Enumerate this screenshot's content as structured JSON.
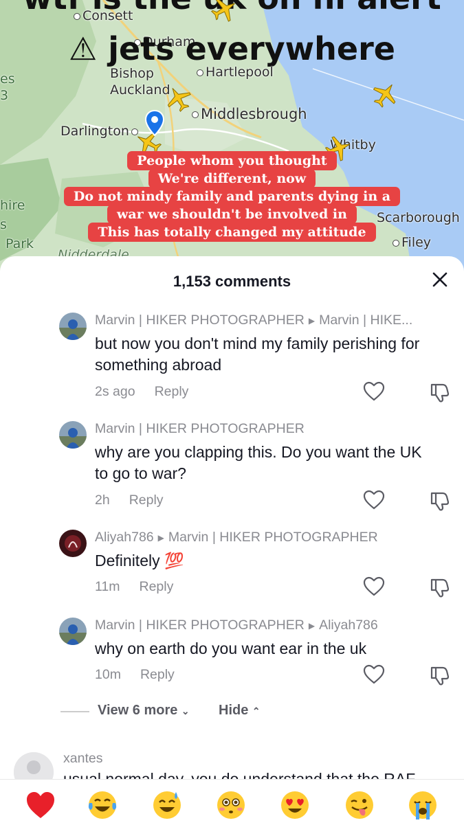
{
  "map": {
    "title_cut": "wtf is the uk on hi alert",
    "title_main": "⚠ jets everywhere",
    "places": {
      "consett": "Consett",
      "durham": "Durham",
      "bishop": "Bishop",
      "auckland": "Auckland",
      "hartlepool": "Hartlepool",
      "middlesbrough": "Middlesbrough",
      "darlington": "Darlington",
      "whitby": "Whitby",
      "scarborough": "Scarborough",
      "filey": "Filey",
      "nidderdale": "Nidderdale",
      "left_es": "es",
      "left_3": "3",
      "left_hire": "hire",
      "left_s": "s",
      "left_park": "Park"
    },
    "caption": [
      "People whom you thought",
      "We're different, now",
      "Do not mindy family and parents dying in a",
      "war we shouldn't be involved in",
      "This has totally changed my attitude"
    ],
    "colors": {
      "caption_bg": "#e74343",
      "sea": "#a9cbf5",
      "land": "#cfe3c6"
    }
  },
  "comments_sheet": {
    "title": "1,153 comments",
    "close_icon": "close-icon",
    "comments": [
      {
        "author": "Marvin | HIKER PHOTOGRAPHER",
        "reply_to": "Marvin | HIKE...",
        "text": "but now you don't mind my family perishing for something abroad",
        "time": "2s ago",
        "reply_label": "Reply"
      },
      {
        "author": "Marvin | HIKER PHOTOGRAPHER",
        "reply_to": "",
        "text": "why are you clapping this. Do you want the UK to go to war?",
        "time": "2h",
        "reply_label": "Reply"
      },
      {
        "author": "Aliyah786",
        "reply_to": "Marvin | HIKER PHOTOGRAPHER",
        "text": "Definitely 💯",
        "time": "11m",
        "reply_label": "Reply"
      },
      {
        "author": "Marvin | HIKER PHOTOGRAPHER",
        "reply_to": "Aliyah786",
        "text": "why on earth do you want ear in the uk",
        "time": "10m",
        "reply_label": "Reply"
      }
    ],
    "view_more": "View 6 more",
    "hide": "Hide",
    "next_comment": {
      "author": "xantes",
      "text": "usual normal day. you do understand that the RAF"
    }
  },
  "emoji_bar": [
    "❤️",
    "😂",
    "😅",
    "😳",
    "😍",
    "😜",
    "😭"
  ]
}
